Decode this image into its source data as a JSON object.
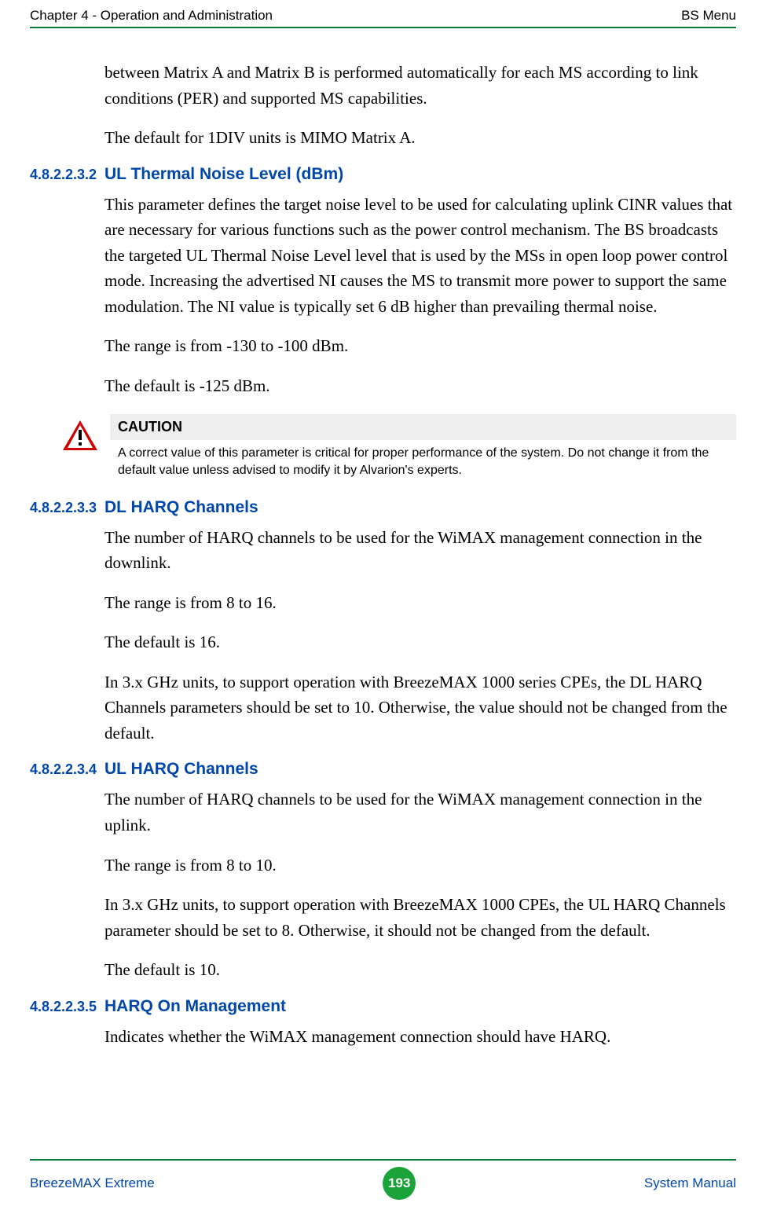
{
  "header": {
    "left": "Chapter 4 - Operation and Administration",
    "right": "BS Menu"
  },
  "intro": {
    "p1": "between Matrix A and Matrix B is performed automatically for each MS according to link conditions (PER) and supported MS capabilities.",
    "p2": "The default for 1DIV units is MIMO Matrix A."
  },
  "sections": [
    {
      "num": "4.8.2.2.3.2",
      "title": "UL Thermal Noise Level (dBm)",
      "paras": [
        "This parameter defines the target noise level to be used for calculating uplink CINR values that are necessary for various functions such as the power control mechanism. The BS broadcasts the targeted UL Thermal Noise Level level that is used by the MSs in open loop power control mode. Increasing the advertised NI causes the MS to transmit more power to support the same modulation. The NI value is typically set 6 dB higher than prevailing thermal noise.",
        "The range is from -130 to -100 dBm.",
        "The default is -125 dBm."
      ]
    },
    {
      "num": "4.8.2.2.3.3",
      "title": "DL HARQ Channels",
      "paras": [
        "The number of HARQ channels to be used for the WiMAX management connection in the downlink.",
        "The range is from 8 to 16.",
        "The default is 16.",
        "In 3.x GHz units, to support operation with BreezeMAX 1000 series CPEs, the DL HARQ Channels parameters should be set to 10. Otherwise, the value should not be changed from the default."
      ]
    },
    {
      "num": "4.8.2.2.3.4",
      "title": "UL HARQ Channels",
      "paras": [
        "The number of HARQ channels to be used for the WiMAX management connection in the uplink.",
        "The range is from 8 to 10.",
        "In 3.x GHz units, to support operation with BreezeMAX 1000 CPEs, the UL HARQ Channels parameter should be set to 8. Otherwise, it should not be changed from the default.",
        "The default is 10."
      ]
    },
    {
      "num": "4.8.2.2.3.5",
      "title": "HARQ On Management",
      "paras": [
        "Indicates whether the WiMAX management connection should have HARQ."
      ]
    }
  ],
  "callout": {
    "head": "CAUTION",
    "text": "A correct value of this parameter is critical for proper performance of the system. Do not change it from the default value unless advised to modify it by Alvarion's experts."
  },
  "footer": {
    "left": "BreezeMAX Extreme",
    "pagenum": "193",
    "right": "System Manual"
  }
}
